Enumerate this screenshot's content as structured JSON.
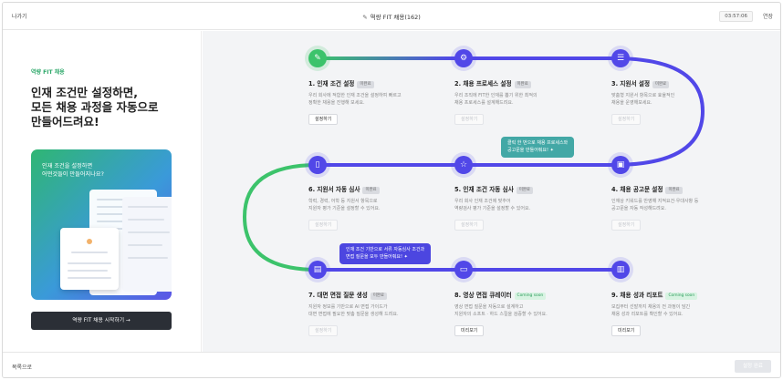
{
  "topbar": {
    "back_label": "나가기",
    "title": "역량 FIT 채용(162)",
    "timer": "03:57:06",
    "save_label": "연장"
  },
  "left": {
    "subtitle": "역량 FIT 채용",
    "headline": "인재 조건만 설정하면,\n모든 채용 과정을 자동으로\n만들어드려요!",
    "promo_text": "인재 조건을 설정하면\n어떤것들이 만들어지나요?",
    "start_button": "역량 FIT 채용 시작하기 →"
  },
  "steps": [
    {
      "title": "1. 인재 조건 설정",
      "badge": "미완료",
      "badge_style": "gray",
      "desc": "우리 회사에 적합한 인재 조건을 설정하여 빠르고\n정확한 채용을 진행해 보세요.",
      "button": "설정하기",
      "button_enabled": true,
      "icon": "pencil-icon",
      "node": "green"
    },
    {
      "title": "2. 채용 프로세스 설정",
      "badge": "미완료",
      "badge_style": "gray",
      "desc": "우리 조직에 FIT한 인재를 뽑기 위한 최적의\n채용 프로세스를 설계해드려요.",
      "button": "설정하기",
      "button_enabled": false,
      "icon": "process-icon",
      "node": "blue"
    },
    {
      "title": "3. 지원서 설정",
      "badge": "미완료",
      "badge_style": "gray",
      "desc": "맞춤형 지원서 항목으로 효율적인\n채용을 운영해보세요.",
      "button": "설정하기",
      "button_enabled": false,
      "icon": "document-icon",
      "node": "blue"
    },
    {
      "title": "4. 채용 공고문 설정",
      "badge": "미완료",
      "badge_style": "gray",
      "desc": "인재상 키워드를 반영해 지적요건·우대사항 등\n공고문을 자동 작성해드려요.",
      "button": "설정하기",
      "button_enabled": false,
      "icon": "briefcase-icon",
      "node": "blue"
    },
    {
      "title": "5. 인재 조건 자동 심사",
      "badge": "미완료",
      "badge_style": "gray",
      "desc": "우리 회사 인재 조건에 맞추어\n역량검사 평가 기준을 설정할 수 있어요.",
      "button": "설정하기",
      "button_enabled": false,
      "icon": "star-icon",
      "node": "blue"
    },
    {
      "title": "6. 지원서 자동 심사",
      "badge": "미완료",
      "badge_style": "gray",
      "desc": "학력, 경력, 어학 등 지원서 항목으로\n지원자 평가 기준을 설정할 수 있어요.",
      "button": "설정하기",
      "button_enabled": false,
      "icon": "bookmark-icon",
      "node": "blue"
    },
    {
      "title": "7. 대면 면접 질문 생성",
      "badge": "미완료",
      "badge_style": "gray",
      "desc": "지원자 정보를 기반으로 AI 면접 가이드가\n대면 면접에 필요한 맞춤 질문을 생성해 드려요.",
      "button": "설정하기",
      "button_enabled": false,
      "icon": "interview-icon",
      "node": "blue"
    },
    {
      "title": "8. 영상 면접 큐레이터",
      "badge": "Coming soon",
      "badge_style": "green",
      "desc": "영상 면접 질문을 자동으로 설계하고\n지원자의 소프트 · 하드 스킬을 검증할 수 있어요.",
      "button": "미리보기",
      "button_enabled": true,
      "icon": "monitor-icon",
      "node": "blue"
    },
    {
      "title": "9. 채용 성과 리포트",
      "badge": "Coming soon",
      "badge_style": "green",
      "desc": "모집부터 선발까지 채용의 전 과정이 담긴\n채용 성과 리포트를 확인할 수 있어요.",
      "button": "미리보기",
      "button_enabled": true,
      "icon": "clipboard-icon",
      "node": "blue"
    }
  ],
  "tips": {
    "process_tip": "클릭 한 번으로 채용 프로세스와\n공고문을 만들어줘요! ✦",
    "screening_tip": "인재 조건 기반으로 서류 자동심사 조건과\n면접 질문을 모두 만들어줘요! ✦"
  },
  "bottombar": {
    "list_label": "목록으로",
    "done_label": "설정 완료"
  },
  "colors": {
    "accent_green": "#3cc36b",
    "accent_indigo": "#5147e8",
    "tip_teal": "#43a8a6",
    "dark_button": "#2b2f36"
  }
}
